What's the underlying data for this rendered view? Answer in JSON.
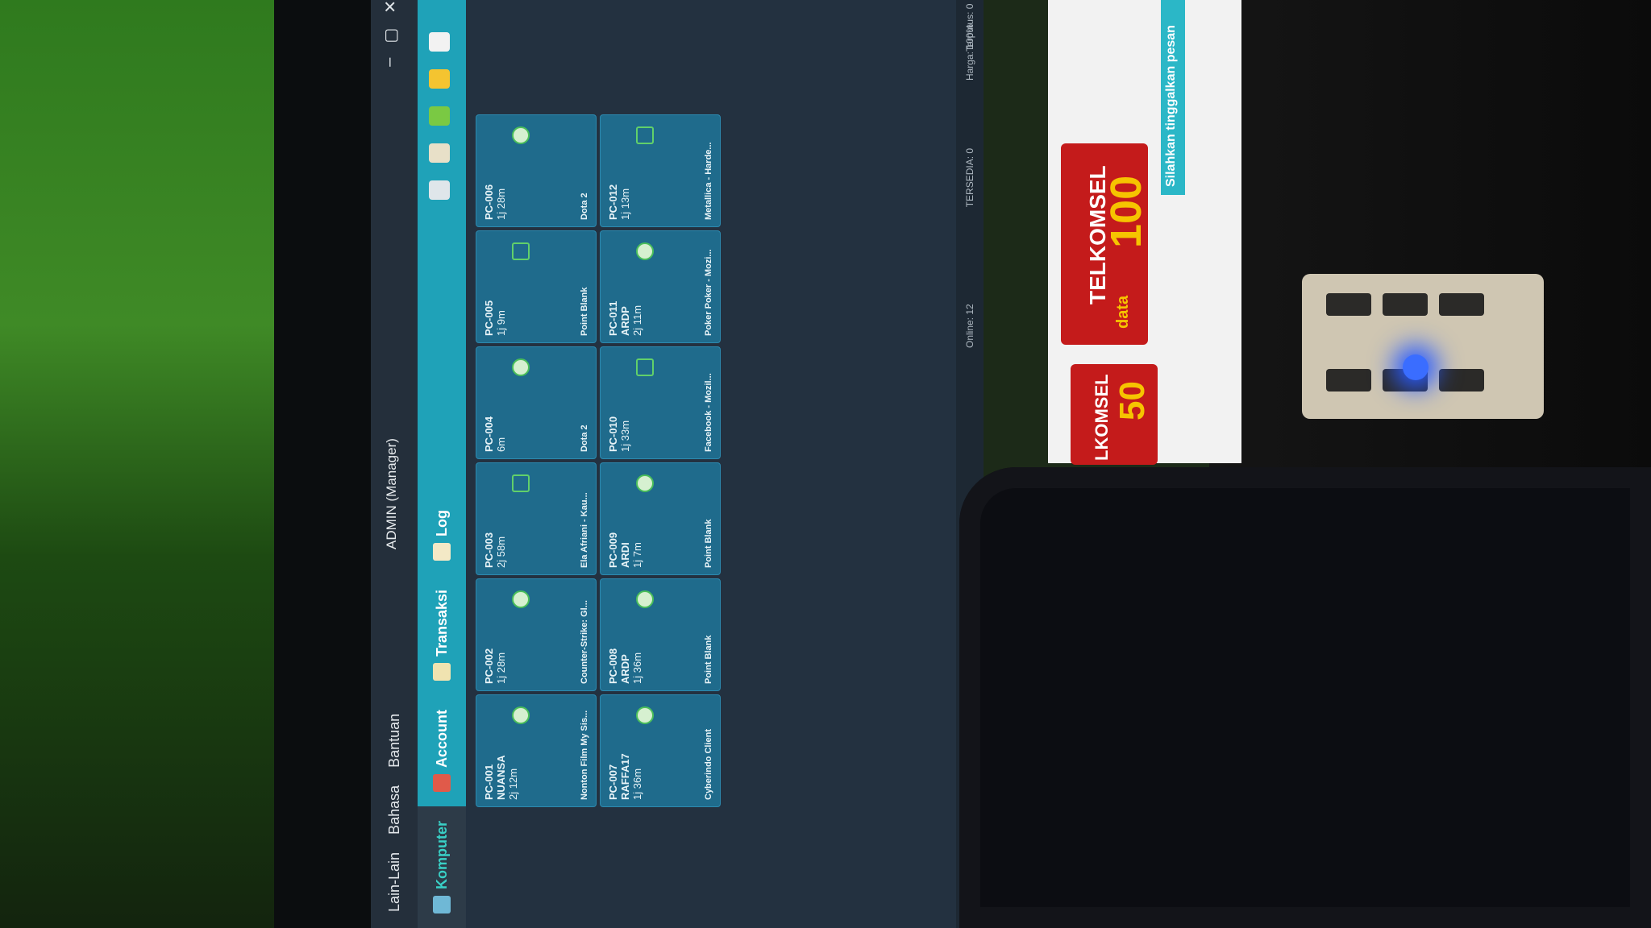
{
  "window": {
    "title": "ADMIN (Manager)",
    "controls": [
      "–",
      "▢",
      "✕"
    ]
  },
  "menu": [
    "Lain-Lain",
    "Bahasa",
    "Bantuan"
  ],
  "tabs": [
    {
      "label": "Komputer",
      "icon": "monitor-icon",
      "active": true
    },
    {
      "label": "Account",
      "icon": "account-icon",
      "active": false
    },
    {
      "label": "Transaksi",
      "icon": "transaction-icon",
      "active": false
    },
    {
      "label": "Log",
      "icon": "log-icon",
      "active": false
    }
  ],
  "computers": [
    {
      "pc": "PC-001",
      "user": "NUANSA",
      "time": "2j 12m",
      "app": "Nonton Film My Sis..."
    },
    {
      "pc": "PC-002",
      "user": "",
      "time": "1j 28m",
      "app": "Counter-Strike: Gl..."
    },
    {
      "pc": "PC-003",
      "user": "",
      "time": "2j 58m",
      "app": "Ela Afriani - Kau..."
    },
    {
      "pc": "PC-004",
      "user": "",
      "time": "6m",
      "app": "Dota 2"
    },
    {
      "pc": "PC-005",
      "user": "",
      "time": "1j 9m",
      "app": "Point Blank"
    },
    {
      "pc": "PC-006",
      "user": "",
      "time": "1j 28m",
      "app": "Dota 2"
    },
    {
      "pc": "PC-007",
      "user": "RAFFA17",
      "time": "1j 36m",
      "app": "Cyberindo Client"
    },
    {
      "pc": "PC-008",
      "user": "ARDP",
      "time": "1j 36m",
      "app": "Point Blank"
    },
    {
      "pc": "PC-009",
      "user": "ARDI",
      "time": "1j 7m",
      "app": "Point Blank"
    },
    {
      "pc": "PC-010",
      "user": "",
      "time": "1j 33m",
      "app": "Facebook - Mozil..."
    },
    {
      "pc": "PC-011",
      "user": "ARDP",
      "time": "2j 11m",
      "app": "Poker Poker - Mozi..."
    },
    {
      "pc": "PC-012",
      "user": "",
      "time": "1j 13m",
      "app": "Metallica - Harde..."
    }
  ],
  "status": {
    "online": "Online: 12",
    "tersedia": "TERSEDIA: 0",
    "terputus": "Terputus: 0",
    "harga": "Harga: 100%"
  },
  "browser": {
    "ad_brand": "TELKOMSEL",
    "ad_main_sub": "data",
    "ad_main_value": "100",
    "ad_second_brand": "LKOMSEL",
    "ad_second_value": "50",
    "chat_label": "Silahkan tinggalkan pesan"
  }
}
